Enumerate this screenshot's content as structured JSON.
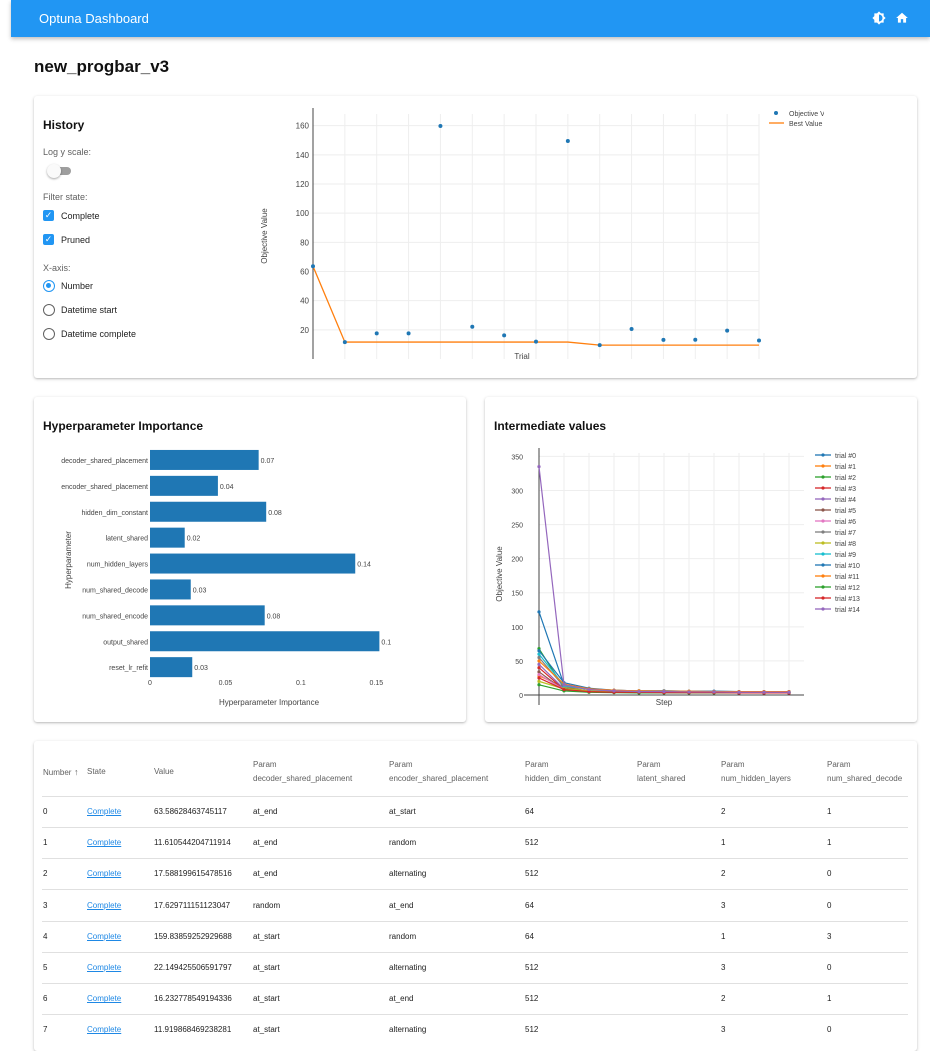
{
  "app": {
    "title": "Optuna Dashboard",
    "theme_icon": "brightness-icon",
    "home_icon": "home-icon"
  },
  "page": {
    "study_name": "new_progbar_v3"
  },
  "history": {
    "title": "History",
    "log_scale_label": "Log y scale:",
    "log_scale_on": false,
    "filter_label": "Filter state:",
    "filters": [
      {
        "label": "Complete",
        "checked": true
      },
      {
        "label": "Pruned",
        "checked": true
      }
    ],
    "xaxis_label": "X-axis:",
    "xaxis_options": [
      {
        "label": "Number",
        "selected": true
      },
      {
        "label": "Datetime start",
        "selected": false
      },
      {
        "label": "Datetime complete",
        "selected": false
      }
    ]
  },
  "importance": {
    "title": "Hyperparameter Importance"
  },
  "intermediate": {
    "title": "Intermediate values"
  },
  "chart_data": [
    {
      "type": "scatter",
      "title": "",
      "xlabel": "Trial",
      "ylabel": "Objective Value",
      "ylim": [
        0,
        168
      ],
      "legend_position": "top-right",
      "grid": true,
      "series": [
        {
          "name": "Objective Value",
          "mode": "markers",
          "color": "#1f77b4",
          "x": [
            0,
            1,
            2,
            3,
            4,
            5,
            6,
            7,
            8,
            9,
            10,
            11,
            12,
            13,
            14
          ],
          "y": [
            63.6,
            11.6,
            17.6,
            17.6,
            159.8,
            22.1,
            16.2,
            11.9,
            149.5,
            9.5,
            20.6,
            13.1,
            13.2,
            19.5,
            12.7
          ]
        },
        {
          "name": "Best Value",
          "mode": "lines",
          "color": "#ff7f0e",
          "x": [
            0,
            1,
            2,
            3,
            4,
            5,
            6,
            7,
            8,
            9,
            10,
            11,
            12,
            13,
            14
          ],
          "y": [
            63.6,
            11.6,
            11.6,
            11.6,
            11.6,
            11.6,
            11.6,
            11.6,
            11.6,
            9.5,
            9.5,
            9.5,
            9.5,
            9.5,
            9.5
          ]
        }
      ],
      "yticks": [
        20,
        40,
        60,
        80,
        100,
        120,
        140,
        160
      ]
    },
    {
      "type": "bar",
      "orientation": "horizontal",
      "xlabel": "Hyperparameter Importance",
      "ylabel": "Hyperparameter",
      "xlim": [
        0,
        0.165
      ],
      "color": "#1f77b4",
      "categories": [
        "decoder_shared_placement",
        "encoder_shared_placement",
        "hidden_dim_constant",
        "latent_shared",
        "num_hidden_layers",
        "num_shared_decode",
        "num_shared_encode",
        "output_shared",
        "reset_lr_refit"
      ],
      "values": [
        0.072,
        0.045,
        0.077,
        0.023,
        0.136,
        0.027,
        0.076,
        0.152,
        0.028
      ],
      "value_labels": [
        "0.07",
        "0.04",
        "0.08",
        "0.02",
        "0.14",
        "0.03",
        "0.08",
        "0.1",
        "0.03"
      ],
      "xticks": [
        "0",
        "0.05",
        "0.1",
        "0.15"
      ]
    },
    {
      "type": "line",
      "xlabel": "Step",
      "ylabel": "Objective Value",
      "ylim": [
        0,
        355
      ],
      "yticks": [
        0,
        50,
        100,
        150,
        200,
        250,
        300,
        350
      ],
      "x": [
        0,
        1,
        2,
        3,
        4,
        5,
        6,
        7,
        8,
        9,
        10
      ],
      "legend_position": "right",
      "series": [
        {
          "name": "trial #0",
          "color": "#1f77b4",
          "values": [
            122,
            15,
            8,
            6,
            5,
            5,
            4.5,
            4.5,
            4,
            4,
            4
          ]
        },
        {
          "name": "trial #1",
          "color": "#ff7f0e",
          "values": [
            28,
            12,
            6,
            5,
            4,
            4,
            4,
            3.5,
            3.5,
            3.5,
            3.5
          ]
        },
        {
          "name": "trial #2",
          "color": "#2ca02c",
          "values": [
            68,
            10,
            6,
            5,
            5,
            4.5,
            4.5,
            4,
            4,
            4,
            4
          ]
        },
        {
          "name": "trial #3",
          "color": "#d62728",
          "values": [
            40,
            8,
            5,
            4,
            4,
            3.5,
            3.5,
            3.5,
            3,
            3,
            3
          ]
        },
        {
          "name": "trial #4",
          "color": "#9467bd",
          "values": [
            45,
            9,
            6,
            5,
            5,
            4.5,
            4.5,
            4,
            4,
            4,
            4
          ]
        },
        {
          "name": "trial #5",
          "color": "#8c564b",
          "values": [
            34,
            7,
            5,
            4,
            4,
            3.5,
            3.5,
            3.5,
            3,
            3,
            3
          ]
        },
        {
          "name": "trial #6",
          "color": "#e377c2",
          "values": [
            30,
            8,
            5,
            4.5,
            4,
            4,
            4,
            3.5,
            3.5,
            3.5,
            3.5
          ]
        },
        {
          "name": "trial #7",
          "color": "#7f7f7f",
          "values": [
            55,
            12,
            9,
            7,
            6,
            6,
            5.5,
            5.5,
            5,
            5,
            5
          ]
        },
        {
          "name": "trial #8",
          "color": "#bcbd22",
          "values": [
            20,
            9,
            6,
            5,
            4.5,
            4.5,
            4,
            4,
            4,
            4,
            4
          ]
        },
        {
          "name": "trial #9",
          "color": "#17becf",
          "values": [
            60,
            14,
            8,
            6,
            5,
            5,
            4.5,
            4.5,
            4,
            4,
            4
          ]
        },
        {
          "name": "trial #10",
          "color": "#1f77b4",
          "values": [
            65,
            18,
            10,
            7,
            6,
            6,
            5.5,
            5.5,
            5,
            5,
            5
          ]
        },
        {
          "name": "trial #11",
          "color": "#ff7f0e",
          "values": [
            50,
            16,
            9,
            7,
            6,
            5.5,
            5.5,
            5,
            5,
            5,
            5
          ]
        },
        {
          "name": "trial #12",
          "color": "#2ca02c",
          "values": [
            15,
            6,
            4,
            3.5,
            3,
            3,
            3,
            3,
            3,
            3,
            3
          ]
        },
        {
          "name": "trial #13",
          "color": "#d62728",
          "values": [
            25,
            8,
            5,
            4,
            4,
            3.5,
            3.5,
            3.5,
            3,
            3,
            3
          ]
        },
        {
          "name": "trial #14",
          "color": "#9467bd",
          "values": [
            335,
            15,
            8,
            6,
            5,
            5,
            4.5,
            4.5,
            4,
            4,
            4
          ]
        }
      ]
    }
  ],
  "table": {
    "headers": [
      {
        "line1": "Number",
        "line2": "",
        "sort_icon": "arrow-up-icon"
      },
      {
        "line1": "State",
        "line2": ""
      },
      {
        "line1": "Value",
        "line2": ""
      },
      {
        "line1": "Param",
        "line2": "decoder_shared_placement"
      },
      {
        "line1": "Param",
        "line2": "encoder_shared_placement"
      },
      {
        "line1": "Param",
        "line2": "hidden_dim_constant"
      },
      {
        "line1": "Param",
        "line2": "latent_shared"
      },
      {
        "line1": "Param",
        "line2": "num_hidden_layers"
      },
      {
        "line1": "Param",
        "line2": "num_shared_decode"
      }
    ],
    "rows": [
      [
        "0",
        "Complete",
        "63.58628463745117",
        "at_end",
        "at_start",
        "64",
        "",
        "2",
        "1"
      ],
      [
        "1",
        "Complete",
        "11.610544204711914",
        "at_end",
        "random",
        "512",
        "",
        "1",
        "1"
      ],
      [
        "2",
        "Complete",
        "17.588199615478516",
        "at_end",
        "alternating",
        "512",
        "",
        "2",
        "0"
      ],
      [
        "3",
        "Complete",
        "17.629711151123047",
        "random",
        "at_end",
        "64",
        "",
        "3",
        "0"
      ],
      [
        "4",
        "Complete",
        "159.83859252929688",
        "at_start",
        "random",
        "64",
        "",
        "1",
        "3"
      ],
      [
        "5",
        "Complete",
        "22.149425506591797",
        "at_start",
        "alternating",
        "512",
        "",
        "3",
        "0"
      ],
      [
        "6",
        "Complete",
        "16.232778549194336",
        "at_start",
        "at_end",
        "512",
        "",
        "2",
        "1"
      ],
      [
        "7",
        "Complete",
        "11.919868469238281",
        "at_start",
        "alternating",
        "512",
        "",
        "3",
        "0"
      ]
    ]
  }
}
